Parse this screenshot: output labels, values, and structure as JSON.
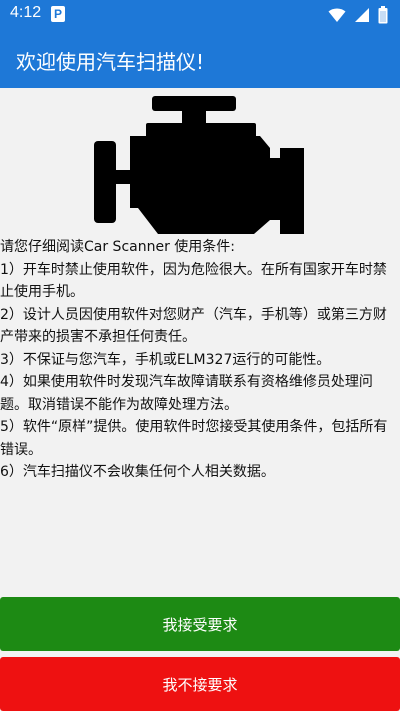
{
  "status_bar": {
    "time": "4:12",
    "notification_badge": "P",
    "background": "#1e78d7"
  },
  "app_bar": {
    "title": "欢迎使用汽车扫描仪!",
    "background": "#1e78d7"
  },
  "hero_icon": "car-engine-icon",
  "terms": {
    "intro": "请您仔细阅读Car Scanner 使用条件:",
    "items": [
      "1）开车时禁止使用软件，因为危险很大。在所有国家开车时禁止使用手机。",
      "2）设计人员因使用软件对您财产（汽车，手机等）或第三方财产带来的损害不承担任何责任。",
      "3）不保证与您汽车，手机或ELM327运行的可能性。",
      "4）如果使用软件时发现汽车故障请联系有资格维修员处理问题。取消错误不能作为故障处理方法。",
      "5）软件“原样”提供。使用软件时您接受其使用条件，包括所有错误。",
      "6）汽车扫描仪不会收集任何个人相关数据。"
    ]
  },
  "buttons": {
    "accept_label": "我接受要求",
    "decline_label": "我不接要求",
    "accept_color": "#1d8a14",
    "decline_color": "#ee1111"
  }
}
